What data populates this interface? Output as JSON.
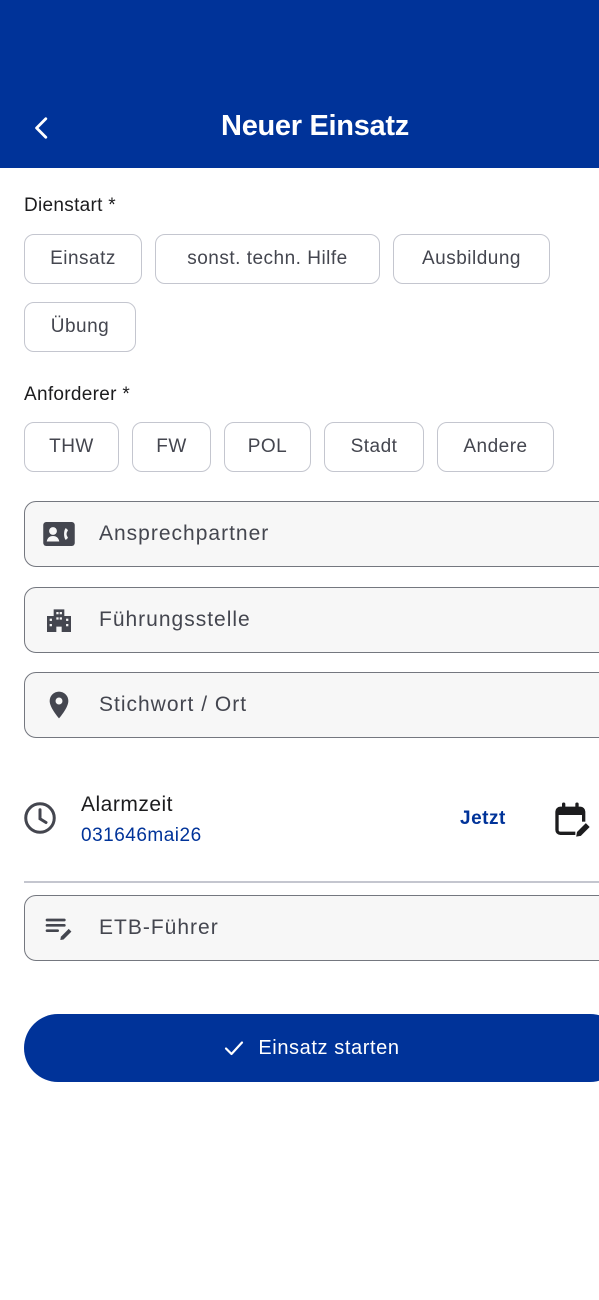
{
  "header": {
    "title": "Neuer Einsatz",
    "background_color": "#003399",
    "back_icon": "arrow-back-icon"
  },
  "dienstart": {
    "label": "Dienstart *",
    "options": [
      "Einsatz",
      "sonst. techn. Hilfe",
      "Ausbildung",
      "Übung"
    ]
  },
  "anforderer": {
    "label": "Anforderer *",
    "options": [
      "THW",
      "FW",
      "POL",
      "Stadt",
      "Andere"
    ]
  },
  "fields": {
    "contact": {
      "placeholder": "Ansprechpartner",
      "icon": "contact-card-icon"
    },
    "command": {
      "placeholder": "Führungsstelle",
      "icon": "building-icon"
    },
    "keyword": {
      "placeholder": "Stichwort / Ort",
      "icon": "location-pin-icon"
    },
    "etb": {
      "placeholder": "ETB-Führer",
      "icon": "edit-note-icon"
    }
  },
  "alarm": {
    "label": "Alarmzeit",
    "value": "031646mai26",
    "now_label": "Jetzt",
    "icon": "clock-icon",
    "calendar_icon": "calendar-edit-icon"
  },
  "actions": {
    "start_label": "Einsatz starten",
    "start_icon": "check-icon"
  },
  "colors": {
    "primary": "#003399",
    "chip_border": "#c4c6cf",
    "field_border": "#74777f"
  }
}
